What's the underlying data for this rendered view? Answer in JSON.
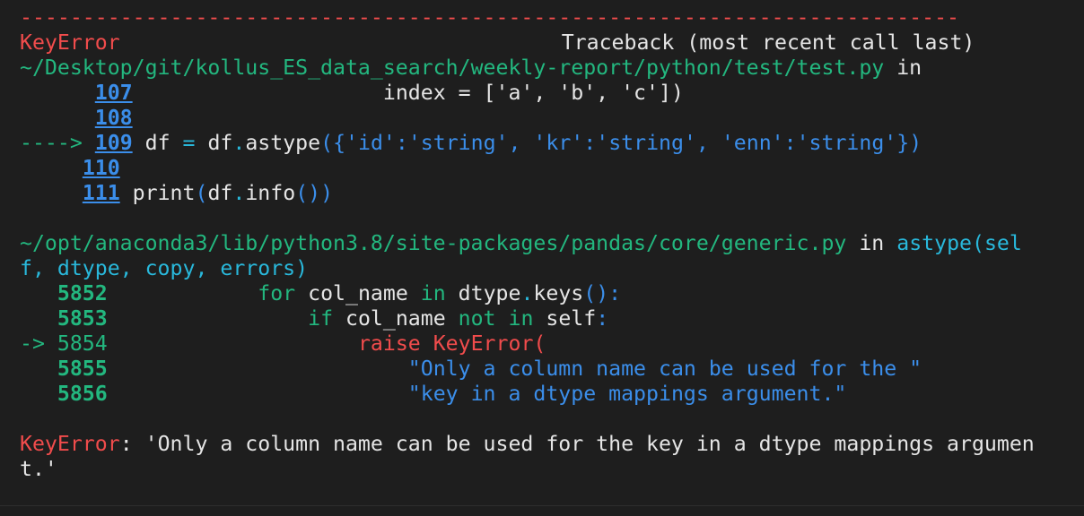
{
  "error": {
    "separator": "---------------------------------------------------------------------------",
    "name": "KeyError",
    "traceback_header": "Traceback (most recent call last)"
  },
  "frame1": {
    "path": "~/Desktop/git/kollus_ES_data_search/weekly-report/python/test/test.py",
    "in_word": "in",
    "lines": [
      {
        "num": "107",
        "code": "                    index = ['a', 'b', 'c'])"
      },
      {
        "num": "108",
        "code": ""
      },
      {
        "arrow": "---->",
        "num": "109",
        "code_df": "df",
        "code_eq": " = ",
        "code_df2": "df",
        "code_dot": ".",
        "code_fn": "astype",
        "code_args": "({'id':'string', 'kr':'string', 'enn':'string'})"
      },
      {
        "num": "110",
        "code": ""
      },
      {
        "num": "111",
        "code_print": "print",
        "code_p1": "(",
        "code_df": "df",
        "code_dot": ".",
        "code_fn": "info",
        "code_p2": "())"
      }
    ]
  },
  "frame2": {
    "path": "~/opt/anaconda3/lib/python3.8/site-packages/pandas/core/generic.py",
    "in_word": "in",
    "func_line1": "astype(sel",
    "func_line2": "f, dtype, copy, errors)",
    "lines": [
      {
        "num": "5852",
        "indent": "            ",
        "kw": "for",
        "rest1": " col_name ",
        "kw2": "in",
        "rest2": " dtype",
        "dot": ".",
        "fn": "keys",
        "tail": "():"
      },
      {
        "num": "5853",
        "indent": "                ",
        "kw": "if",
        "rest1": " col_name ",
        "kw2": "not in",
        "rest2": " self",
        "tail": ":"
      },
      {
        "arrow": "-> ",
        "num": "5854",
        "indent": "                    ",
        "raise_kw": "raise",
        "exc": "KeyError",
        "tail": "("
      },
      {
        "num": "5855",
        "indent": "                        ",
        "str": "\"Only a column name can be used for the \""
      },
      {
        "num": "5856",
        "indent": "                        ",
        "str": "\"key in a dtype mappings argument.\""
      }
    ]
  },
  "final": {
    "name": "KeyError",
    "message_line1": ": 'Only a column name can be used for the key in a dtype mappings argumen",
    "message_line2": "t.'"
  },
  "colors": {
    "background": "#1e1e1e",
    "red": "#f14c4c",
    "green": "#23b77f",
    "blue": "#3b8eea",
    "cyan": "#29b8db"
  }
}
